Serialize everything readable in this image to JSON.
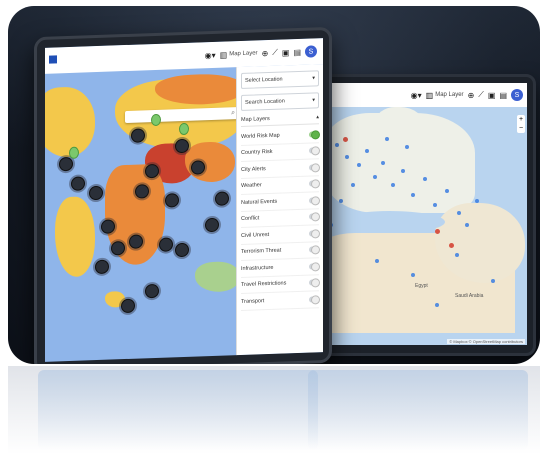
{
  "front_tablet": {
    "toolbar": {
      "map_button_label": "Map Layer",
      "user_initial": "S"
    },
    "search": {
      "icon": "search-icon"
    },
    "panel": {
      "dropdown1": "Select Location",
      "dropdown2": "Search Location",
      "layers_title": "Map Layers",
      "layers": [
        {
          "label": "World Risk Map",
          "on": true
        },
        {
          "label": "Country Risk",
          "on": false
        },
        {
          "label": "City Alerts",
          "on": false
        },
        {
          "label": "Weather",
          "on": false
        },
        {
          "label": "Natural Events",
          "on": false
        },
        {
          "label": "Conflict",
          "on": false
        },
        {
          "label": "Civil Unrest",
          "on": false
        },
        {
          "label": "Terrorism Threat",
          "on": false
        },
        {
          "label": "Infrastructure",
          "on": false
        },
        {
          "label": "Travel Restrictions",
          "on": false
        },
        {
          "label": "Transport",
          "on": false
        }
      ]
    },
    "colors": {
      "ocean": "#8fb5ea",
      "land_yellow": "#f3c84b",
      "land_orange": "#ea8a3a",
      "land_red": "#c9412e",
      "land_green": "#a9d08e"
    }
  },
  "back_tablet": {
    "toolbar": {
      "map_button_label": "Map Layer",
      "user_initial": "S"
    },
    "map_labels": [
      "Egypt",
      "Saudi Arabia"
    ],
    "attribution": "© Mapbox © OpenStreetMap contributors"
  }
}
